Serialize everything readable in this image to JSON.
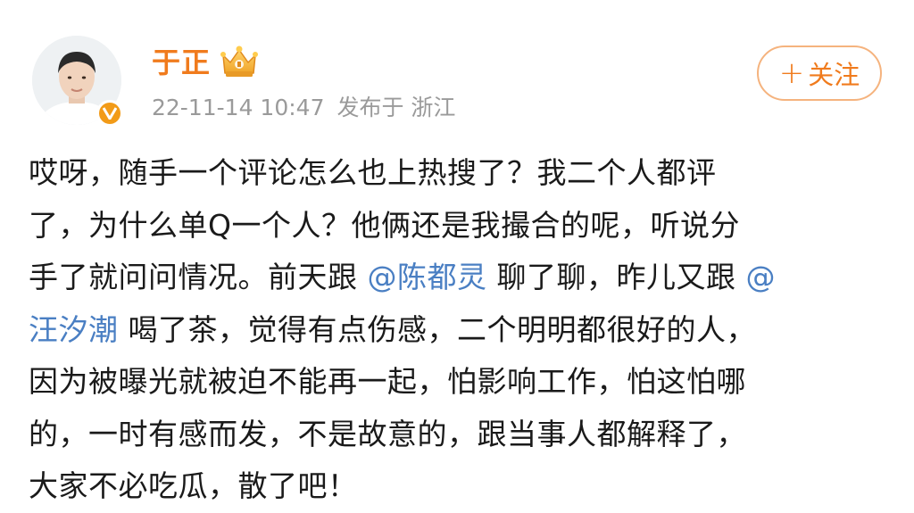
{
  "author": {
    "name": "于正",
    "avatar": "avatar",
    "verified_icon": "verified-v-icon",
    "member_icon": "crown-icon",
    "accent_color": "#f07b1d"
  },
  "meta": {
    "timestamp": "22-11-14 10:47",
    "source": "发布于 浙江"
  },
  "follow_button": {
    "plus": "+",
    "label": "关注"
  },
  "post": {
    "lines": [
      {
        "segments": [
          {
            "text": "哎呀，随手一个评论怎么也上热搜了？我二个人都评"
          }
        ]
      },
      {
        "segments": [
          {
            "text": "了，为什么单Q一个人？他俩还是我撮合的呢，听说分"
          }
        ]
      },
      {
        "segments": [
          {
            "text": "手了就问问情况。前天跟 "
          },
          {
            "text": "@陈都灵",
            "mention": true
          },
          {
            "text": " 聊了聊，昨儿又跟 "
          },
          {
            "text": "@",
            "mention": true
          }
        ]
      },
      {
        "segments": [
          {
            "text": "汪汐潮",
            "mention": true
          },
          {
            "text": " 喝了茶，觉得有点伤感，二个明明都很好的人，"
          }
        ]
      },
      {
        "segments": [
          {
            "text": "因为被曝光就被迫不能再一起，怕影响工作，怕这怕哪"
          }
        ]
      },
      {
        "segments": [
          {
            "text": "的，一时有感而发，不是故意的，跟当事人都解释了，"
          }
        ]
      },
      {
        "segments": [
          {
            "text": "大家不必吃瓜，散了吧！"
          }
        ]
      }
    ],
    "mention_color": "#4a7fc3"
  }
}
